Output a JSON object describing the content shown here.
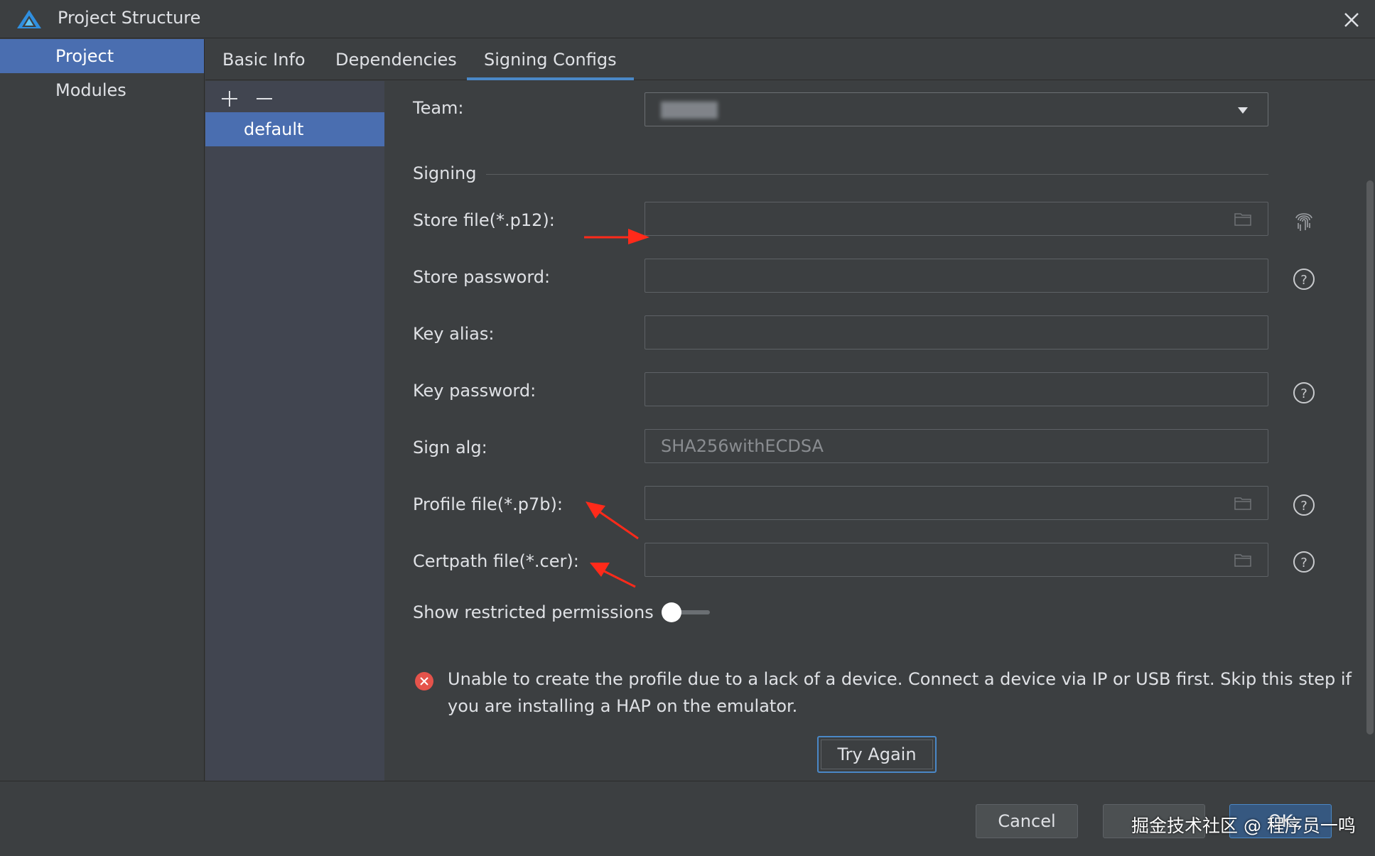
{
  "window": {
    "title": "Project Structure",
    "logo_icon": "harmony-logo-icon"
  },
  "nav": {
    "items": [
      {
        "label": "Project",
        "selected": true
      },
      {
        "label": "Modules",
        "selected": false
      }
    ]
  },
  "tabs": [
    {
      "label": "Basic Info"
    },
    {
      "label": "Dependencies"
    },
    {
      "label": "Signing Configs",
      "active": true
    }
  ],
  "configs": {
    "add_icon": "plus-icon",
    "remove_icon": "minus-icon",
    "items": [
      "default"
    ]
  },
  "form": {
    "team_label": "Team:",
    "signing_section": "Signing",
    "store_file_label": "Store file(*.p12):",
    "store_file_value": "",
    "store_password_label": "Store password:",
    "store_password_value": "",
    "key_alias_label": "Key alias:",
    "key_alias_value": "",
    "key_password_label": "Key password:",
    "key_password_value": "",
    "sign_alg_label": "Sign alg:",
    "sign_alg_value": "SHA256withECDSA",
    "profile_file_label": "Profile file(*.p7b):",
    "profile_file_value": "",
    "certpath_file_label": "Certpath file(*.cer):",
    "certpath_file_value": "",
    "show_restricted_label": "Show restricted permissions",
    "show_restricted_on": false
  },
  "error": {
    "message": "Unable to create the profile due to a lack of a device. Connect a device via IP or USB first. Skip this step if you are installing a HAP on the emulator."
  },
  "buttons": {
    "try_again": "Try Again",
    "cancel": "Cancel",
    "ok": "OK"
  },
  "watermark": "掘金技术社区 @ 程序员一鸣",
  "colors": {
    "background": "#3c3f41",
    "selection": "#4a6eb0",
    "accent": "#4a88c7",
    "error": "#e5534b",
    "annotation_arrow": "#ff2a1a"
  }
}
